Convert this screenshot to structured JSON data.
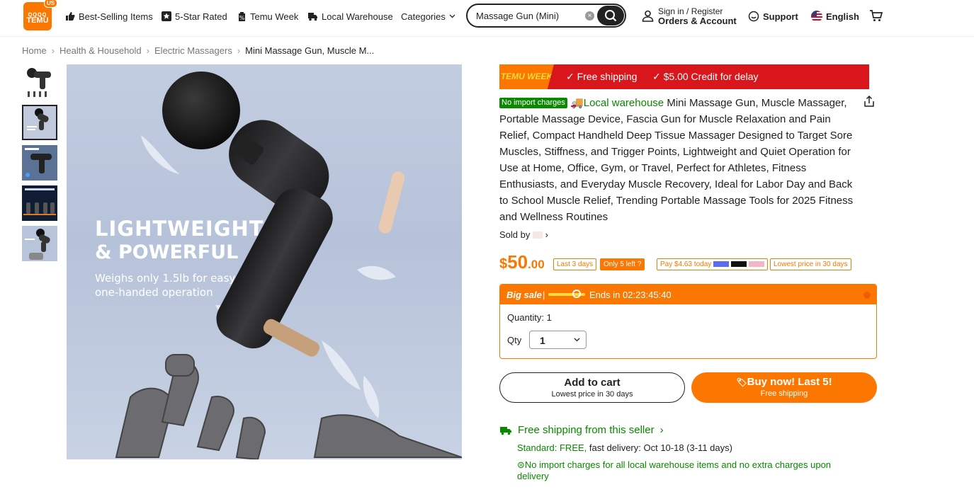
{
  "header": {
    "logo_line1": "ꞯꞯꞯꞯ",
    "logo_text": "TEMU",
    "logo_region": "US",
    "nav": [
      {
        "label": "Best-Selling Items",
        "icon": "thumbs-up-icon"
      },
      {
        "label": "5-Star Rated",
        "icon": "star-icon"
      },
      {
        "label": "Temu Week",
        "icon": "percent-tag-icon"
      },
      {
        "label": "Local Warehouse",
        "icon": "truck-icon"
      },
      {
        "label": "Categories",
        "icon": "chevron-down-icon"
      }
    ],
    "search_value": "Massage Gun (Mini)",
    "signin_line1": "Sign in / Register",
    "signin_line2": "Orders & Account",
    "support": "Support",
    "language": "English"
  },
  "breadcrumb": [
    "Home",
    "Health & Household",
    "Electric Massagers",
    "Mini Massage Gun, Muscle M..."
  ],
  "image": {
    "line1": "LIGHTWEIGHT",
    "line2": "& POWERFUL",
    "line3": "Weighs only 1.5lb for easy one-handed operation"
  },
  "banner": {
    "week": "TEMU WEEK",
    "item1": "✓ Free shipping",
    "item2": "✓ $5.00 Credit for delay"
  },
  "product": {
    "tag_import": "No import charges",
    "tag_local": "Local warehouse",
    "title": "Mini Massage Gun, Muscle Massager, Portable Massage Device, Fascia Gun for Muscle Relaxation and Pain Relief, Compact Handheld Deep Tissue Massager Designed to Target Sore Muscles, Stiffness, and Trigger Points, Lightweight and Quiet Operation for Use at Home, Office, Gym, or Travel, Perfect for Athletes, Fitness Enthusiasts, and Everyday Muscle Recovery, Ideal for Labor Day and Back to School Muscle Relief, Trending Portable Massage Tools for 2025 Fitness and Wellness Routines",
    "sold_by": "Sold by",
    "price_symbol": "$",
    "price_int": "50",
    "price_cents": ".00",
    "badges": [
      "Last 3 days",
      "Only 5 left",
      "Pay $4.63 today",
      "Lowest price in 30 days"
    ]
  },
  "sale": {
    "label": "Big sale",
    "sep": "|",
    "ends": "Ends in 02:23:45:40",
    "quantity_text": "Quantity: 1",
    "qty_label": "Qty",
    "qty_value": "1"
  },
  "buttons": {
    "cart_main": "Add to cart",
    "cart_sub": "Lowest price in 30 days",
    "buy_main": "Buy now! Last 5!",
    "buy_sub": "Free shipping"
  },
  "shipping": {
    "title": "Free shipping from this seller",
    "standard_label": "Standard: FREE,",
    "standard_detail": " fast delivery: Oct 10-18 (3-11 days)",
    "note": "No import charges for all local warehouse items and no extra charges upon delivery"
  },
  "colors": {
    "accent": "#fb7701",
    "red": "#d8161b",
    "green": "#0a8800"
  }
}
